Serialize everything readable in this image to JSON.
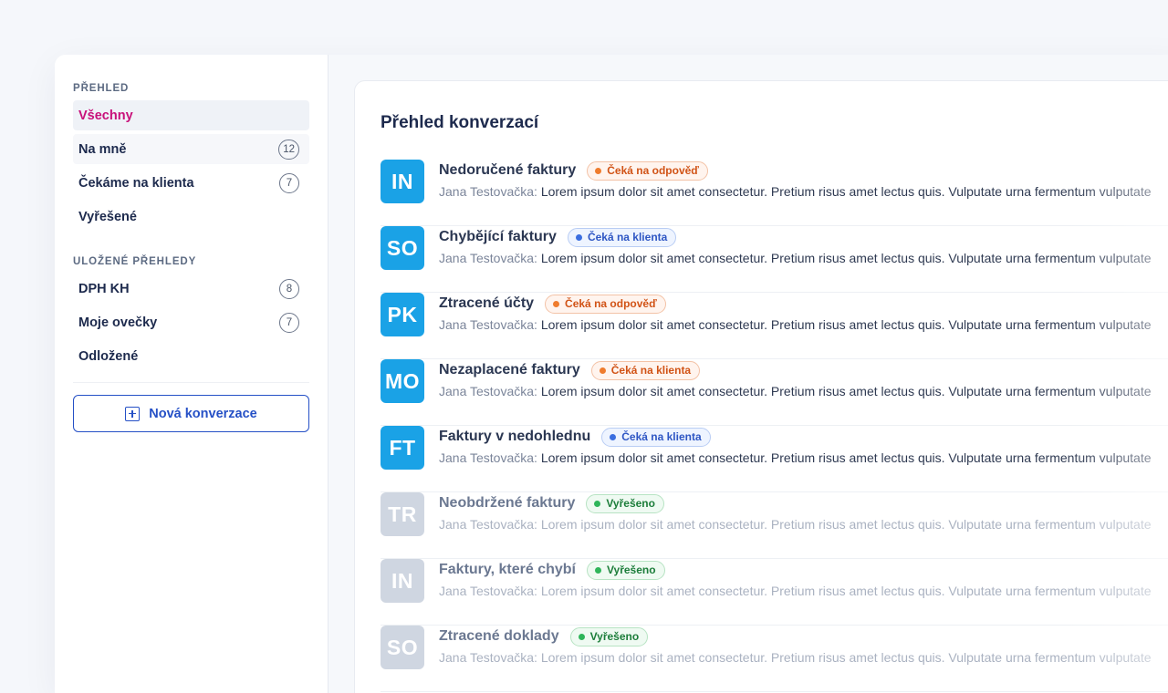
{
  "sidebar": {
    "overview_title": "PŘEHLED",
    "items": [
      {
        "label": "Všechny",
        "count": null
      },
      {
        "label": "Na mně",
        "count": "12"
      },
      {
        "label": "Čekáme na klienta",
        "count": "7"
      },
      {
        "label": "Vyřešené",
        "count": null
      }
    ],
    "saved_title": "ULOŽENÉ PŘEHLEDY",
    "saved_items": [
      {
        "label": "DPH KH",
        "count": "8"
      },
      {
        "label": "Moje ovečky",
        "count": "7"
      },
      {
        "label": "Odložené",
        "count": null
      }
    ],
    "new_button_label": "Nová konverzace",
    "new_button_icon": "plus-square-icon"
  },
  "main": {
    "title": "Přehled konverzací",
    "conversations": [
      {
        "initials": "IN",
        "title": "Nedoručené faktury",
        "status": "Čeká na odpověď",
        "status_color": "orange",
        "author": "Jana Testovačka:",
        "preview": "Lorem ipsum dolor sit amet consectetur. Pretium risus amet lectus quis. Vulputate urna fermentum vulputate",
        "resolved": false
      },
      {
        "initials": "SO",
        "title": "Chybějící faktury",
        "status": "Čeká na klienta",
        "status_color": "blue",
        "author": "Jana Testovačka:",
        "preview": "Lorem ipsum dolor sit amet consectetur. Pretium risus amet lectus quis. Vulputate urna fermentum vulputate",
        "resolved": false
      },
      {
        "initials": "PK",
        "title": "Ztracené účty",
        "status": "Čeká na odpověď",
        "status_color": "orange",
        "author": "Jana Testovačka:",
        "preview": "Lorem ipsum dolor sit amet consectetur. Pretium risus amet lectus quis. Vulputate urna fermentum vulputate",
        "resolved": false
      },
      {
        "initials": "MO",
        "title": "Nezaplacené faktury",
        "status": "Čeká na klienta",
        "status_color": "orange",
        "author": "Jana Testovačka:",
        "preview": "Lorem ipsum dolor sit amet consectetur. Pretium risus amet lectus quis. Vulputate urna fermentum vulputate",
        "resolved": false
      },
      {
        "initials": "FT",
        "title": "Faktury v nedohlednu",
        "status": "Čeká na klienta",
        "status_color": "blue",
        "author": "Jana Testovačka:",
        "preview": "Lorem ipsum dolor sit amet consectetur. Pretium risus amet lectus quis. Vulputate urna fermentum vulputate",
        "resolved": false
      },
      {
        "initials": "TR",
        "title": "Neobdržené faktury",
        "status": "Vyřešeno",
        "status_color": "green",
        "author": "Jana Testovačka:",
        "preview": "Lorem ipsum dolor sit amet consectetur. Pretium risus amet lectus quis. Vulputate urna fermentum vulputate",
        "resolved": true
      },
      {
        "initials": "IN",
        "title": "Faktury, které chybí",
        "status": "Vyřešeno",
        "status_color": "green",
        "author": "Jana Testovačka:",
        "preview": "Lorem ipsum dolor sit amet consectetur. Pretium risus amet lectus quis. Vulputate urna fermentum vulputate",
        "resolved": true
      },
      {
        "initials": "SO",
        "title": "Ztracené doklady",
        "status": "Vyřešeno",
        "status_color": "green",
        "author": "Jana Testovačka:",
        "preview": "Lorem ipsum dolor sit amet consectetur. Pretium risus amet lectus quis. Vulputate urna fermentum vulputate",
        "resolved": true
      }
    ]
  },
  "colors": {
    "accent_pink": "#c8107a",
    "primary_blue": "#2550c6",
    "avatar_blue": "#1aa2e6",
    "avatar_resolved": "#cfd6e1"
  }
}
